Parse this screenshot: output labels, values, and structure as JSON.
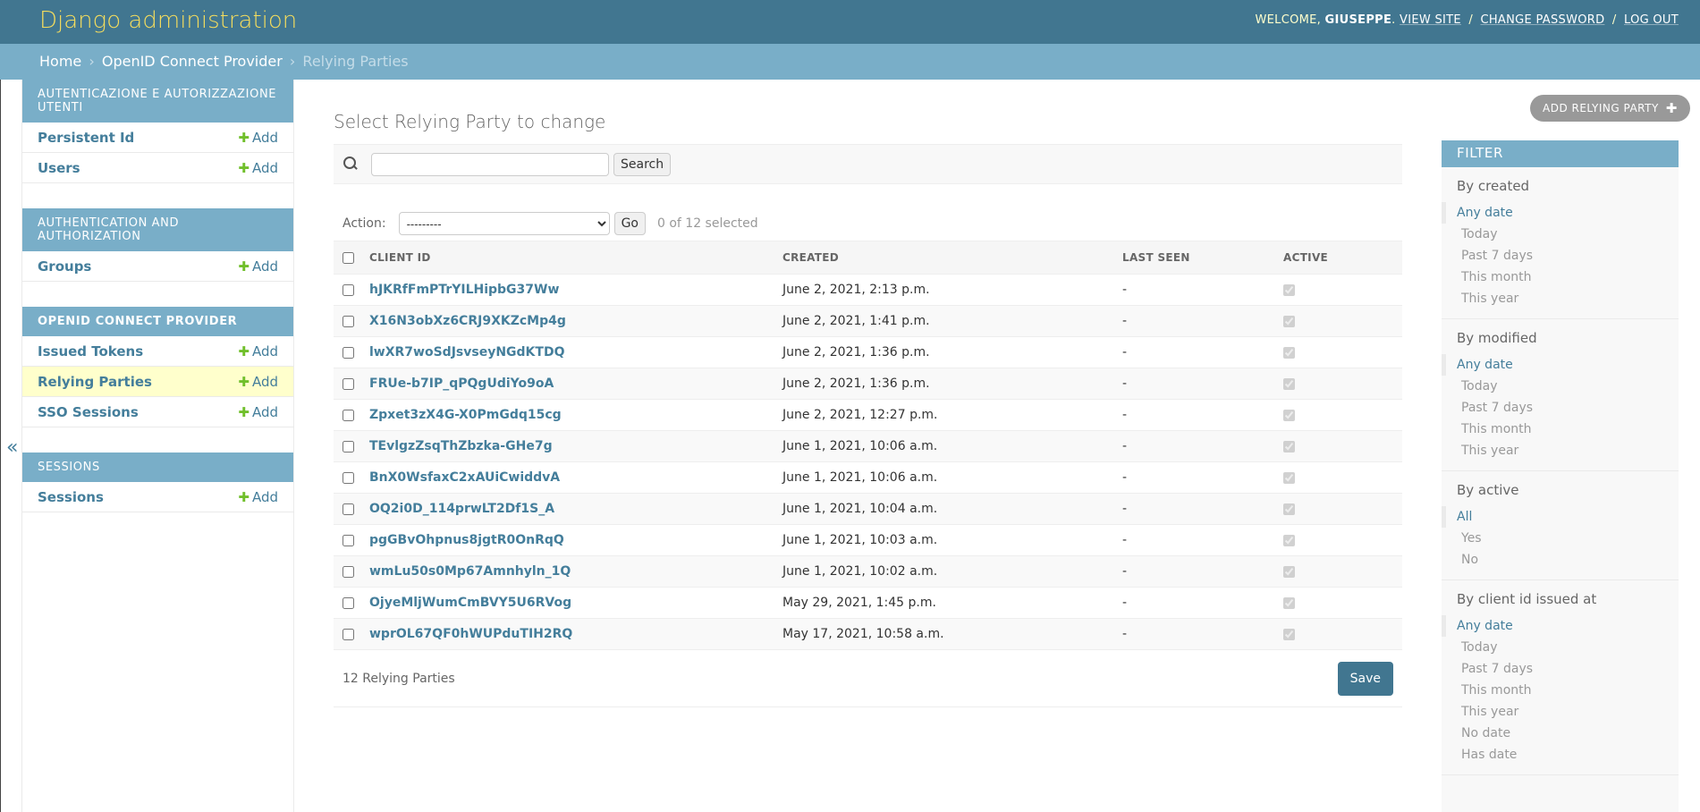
{
  "header": {
    "site_name": "Django administration",
    "welcome": "Welcome,",
    "username": "Giuseppe",
    "view_site": "View site",
    "change_password": "Change password",
    "log_out": "Log out",
    "separator": "/"
  },
  "breadcrumbs": {
    "home": "Home",
    "app": "OpenID Connect Provider",
    "current": "Relying Parties",
    "separator": "›"
  },
  "nav": {
    "collapse_glyph": "«",
    "add_label": "Add",
    "modules": [
      {
        "caption": "Autenticazione e autorizzazione utenti",
        "items": [
          "Persistent Id",
          "Users"
        ]
      },
      {
        "caption": "Authentication and Authorization",
        "items": [
          "Groups"
        ]
      },
      {
        "caption": "OpenID Connect Provider",
        "items": [
          "Issued Tokens",
          "Relying Parties",
          "SSO Sessions"
        ]
      },
      {
        "caption": "Sessions",
        "items": [
          "Sessions"
        ]
      }
    ]
  },
  "content": {
    "title": "Select Relying Party to change",
    "add_button": "Add Relying Party",
    "search_button": "Search",
    "search_value": "",
    "action_label": "Action:",
    "action_selected": "---------",
    "go_button": "Go",
    "action_counter": "0 of 12 selected",
    "columns": [
      "Client ID",
      "Created",
      "Last seen",
      "Active"
    ],
    "rows": [
      {
        "client_id": "hJKRfFmPTrYILHipbG37Ww",
        "created": "June 2, 2021, 2:13 p.m.",
        "last_seen": "-",
        "active": true
      },
      {
        "client_id": "X16N3obXz6CRJ9XKZcMp4g",
        "created": "June 2, 2021, 1:41 p.m.",
        "last_seen": "-",
        "active": true
      },
      {
        "client_id": "lwXR7woSdJsvseyNGdKTDQ",
        "created": "June 2, 2021, 1:36 p.m.",
        "last_seen": "-",
        "active": true
      },
      {
        "client_id": "FRUe-b7IP_qPQgUdiYo9oA",
        "created": "June 2, 2021, 1:36 p.m.",
        "last_seen": "-",
        "active": true
      },
      {
        "client_id": "Zpxet3zX4G-X0PmGdq15cg",
        "created": "June 2, 2021, 12:27 p.m.",
        "last_seen": "-",
        "active": true
      },
      {
        "client_id": "TEvlgzZsqThZbzka-GHe7g",
        "created": "June 1, 2021, 10:06 a.m.",
        "last_seen": "-",
        "active": true
      },
      {
        "client_id": "BnX0WsfaxC2xAUiCwiddvA",
        "created": "June 1, 2021, 10:06 a.m.",
        "last_seen": "-",
        "active": true
      },
      {
        "client_id": "OQ2i0D_114prwLT2Df1S_A",
        "created": "June 1, 2021, 10:04 a.m.",
        "last_seen": "-",
        "active": true
      },
      {
        "client_id": "pgGBvOhpnus8jgtR0OnRqQ",
        "created": "June 1, 2021, 10:03 a.m.",
        "last_seen": "-",
        "active": true
      },
      {
        "client_id": "wmLu50s0Mp67Amnhyln_1Q",
        "created": "June 1, 2021, 10:02 a.m.",
        "last_seen": "-",
        "active": true
      },
      {
        "client_id": "OjyeMljWumCmBVY5U6RVog",
        "created": "May 29, 2021, 1:45 p.m.",
        "last_seen": "-",
        "active": true
      },
      {
        "client_id": "wprOL67QF0hWUPduTIH2RQ",
        "created": "May 17, 2021, 10:58 a.m.",
        "last_seen": "-",
        "active": true
      }
    ],
    "result_count": "12 Relying Parties",
    "save_button": "Save"
  },
  "filter": {
    "title": "Filter",
    "groups": [
      {
        "title": "By created",
        "options": [
          "Any date",
          "Today",
          "Past 7 days",
          "This month",
          "This year"
        ],
        "selected": 0
      },
      {
        "title": "By modified",
        "options": [
          "Any date",
          "Today",
          "Past 7 days",
          "This month",
          "This year"
        ],
        "selected": 0
      },
      {
        "title": "By active",
        "options": [
          "All",
          "Yes",
          "No"
        ],
        "selected": 0
      },
      {
        "title": "By client id issued at",
        "options": [
          "Any date",
          "Today",
          "Past 7 days",
          "This month",
          "This year",
          "No date",
          "Has date"
        ],
        "selected": 0
      }
    ]
  },
  "colors": {
    "header_bg": "#417690",
    "branding": "#f5dd5d",
    "breadcrumb_bg": "#79aec8",
    "link": "#447e9b",
    "add_plus": "#70bf2b",
    "current_model_bg": "#ffffcc",
    "save_button": "#417690"
  }
}
